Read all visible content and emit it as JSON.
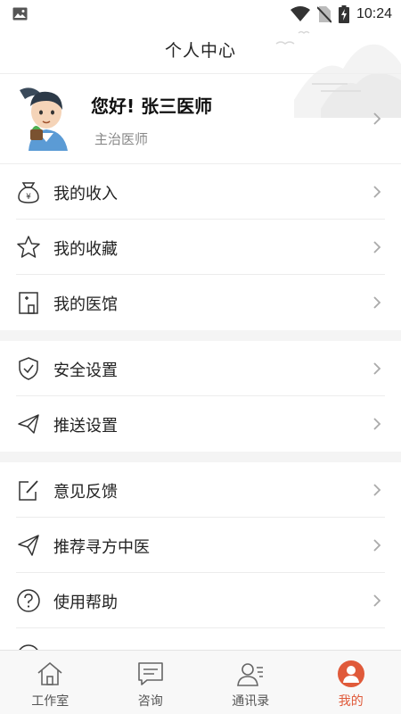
{
  "status_bar": {
    "time": "10:24"
  },
  "header": {
    "title": "个人中心"
  },
  "profile": {
    "greeting": "您好! 张三医师",
    "role": "主治医师"
  },
  "menu_groups": [
    {
      "items": [
        {
          "label": "我的收入",
          "icon": "money-bag-icon"
        },
        {
          "label": "我的收藏",
          "icon": "star-icon"
        },
        {
          "label": "我的医馆",
          "icon": "building-icon"
        }
      ]
    },
    {
      "items": [
        {
          "label": "安全设置",
          "icon": "shield-icon"
        },
        {
          "label": "推送设置",
          "icon": "paper-plane-icon"
        }
      ]
    },
    {
      "items": [
        {
          "label": "意见反馈",
          "icon": "edit-icon"
        },
        {
          "label": "推荐寻方中医",
          "icon": "send-icon"
        },
        {
          "label": "使用帮助",
          "icon": "help-icon"
        }
      ]
    }
  ],
  "tabbar": {
    "tabs": [
      {
        "label": "工作室",
        "icon": "home-icon"
      },
      {
        "label": "咨询",
        "icon": "chat-icon"
      },
      {
        "label": "通讯录",
        "icon": "contacts-icon"
      },
      {
        "label": "我的",
        "icon": "user-icon",
        "active": true
      }
    ]
  },
  "colors": {
    "accent": "#e05a3a",
    "text": "#222222",
    "muted": "#888888",
    "divider": "#ececec",
    "group_gap": "#f4f4f4"
  }
}
